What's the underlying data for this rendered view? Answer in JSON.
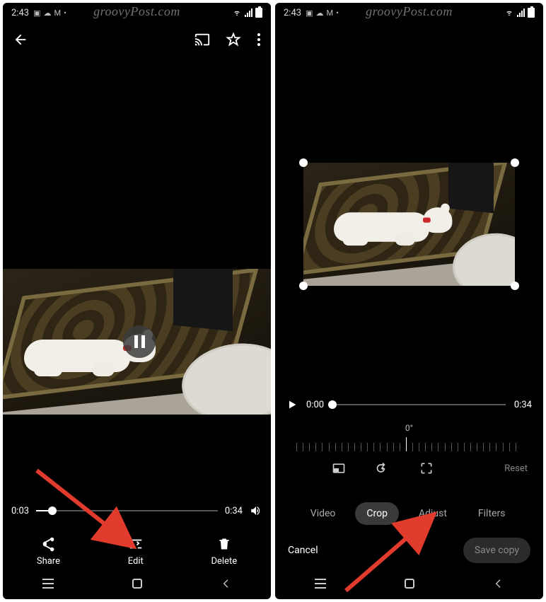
{
  "watermark": "groovyPost.com",
  "status": {
    "time": "2:43"
  },
  "left": {
    "scrub": {
      "current": "0:03",
      "total": "0:34",
      "progressPct": 9
    },
    "actions": {
      "share": "Share",
      "edit": "Edit",
      "delete": "Delete"
    }
  },
  "right": {
    "play": {
      "current": "0:00",
      "total": "0:34",
      "progressPct": 0
    },
    "rotation": "0°",
    "reset": "Reset",
    "tabs": {
      "video": "Video",
      "crop": "Crop",
      "adjust": "Adjust",
      "filters": "Filters"
    },
    "cancel": "Cancel",
    "savecopy": "Save copy"
  }
}
